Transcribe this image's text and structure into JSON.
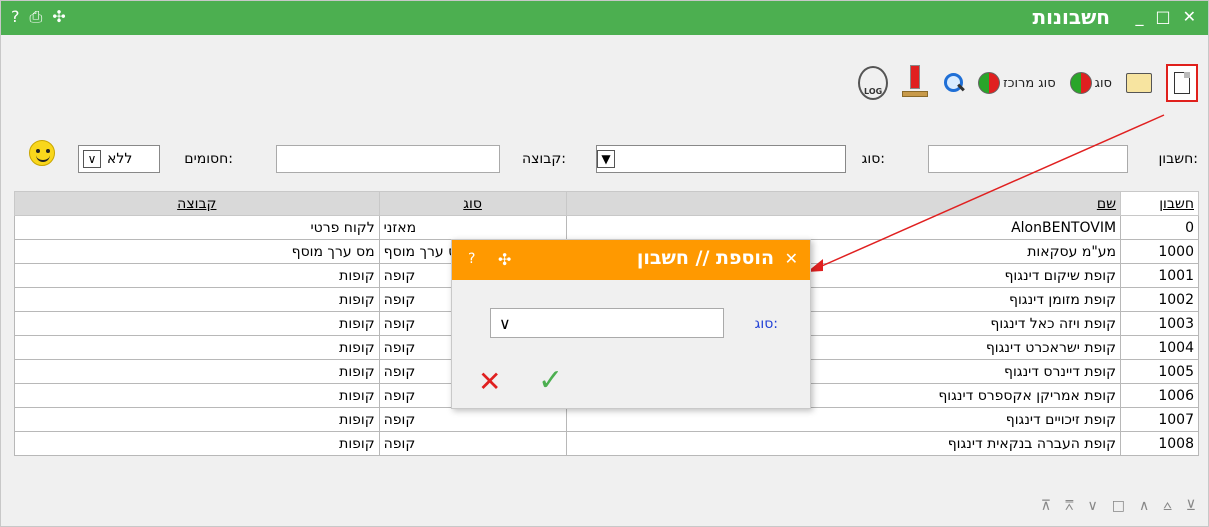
{
  "window": {
    "title": "חשבונות",
    "left_icons": [
      "?",
      "⎙",
      "✣"
    ],
    "controls": [
      "_",
      "□",
      "✕"
    ]
  },
  "toolbar": {
    "type_label": "סוג",
    "type_focus_label": "סוג מרוכז",
    "log_label": "LOG"
  },
  "filter": {
    "account_label": "חשבון:",
    "account_value": "",
    "type_label": "סוג:",
    "type_value": "",
    "group_label": "קבוצה:",
    "group_value": "",
    "blocked_label": "חסומים:",
    "blocked_value": "ללא"
  },
  "table": {
    "headers": {
      "account": "חשבון",
      "name": "שם",
      "type": "סוג",
      "group": "קבוצה"
    },
    "rows": [
      {
        "account": "0",
        "name": "AlonBENTOVIM",
        "type": "מאזני",
        "group": "לקוח פרטי"
      },
      {
        "account": "1000",
        "name": "מע\"מ עסקאות",
        "type": "מס ערך מוסף",
        "group": "מס ערך מוסף"
      },
      {
        "account": "1001",
        "name": "קופת שיקום דינגוף",
        "type": "קופה",
        "group": "קופות"
      },
      {
        "account": "1002",
        "name": "קופת מזומן דינגוף",
        "type": "קופה",
        "group": "קופות"
      },
      {
        "account": "1003",
        "name": "קופת ויזה כאל דינגוף",
        "type": "קופה",
        "group": "קופות"
      },
      {
        "account": "1004",
        "name": "קופת ישראכרט דינגוף",
        "type": "קופה",
        "group": "קופות"
      },
      {
        "account": "1005",
        "name": "קופת דיינרס דינגוף",
        "type": "קופה",
        "group": "קופות"
      },
      {
        "account": "1006",
        "name": "קופת אמריקן אקספרס דינגוף",
        "type": "קופה",
        "group": "קופות"
      },
      {
        "account": "1007",
        "name": "קופת זיכויים דינגוף",
        "type": "קופה",
        "group": "קופות"
      },
      {
        "account": "1008",
        "name": "קופת העברה בנקאית דינגוף",
        "type": "קופה",
        "group": "קופות"
      }
    ]
  },
  "nav": [
    "⊼",
    "⩞",
    "∨",
    "□",
    "∧",
    "⩟",
    "⊻"
  ],
  "dialog": {
    "title": "הוספת // חשבון",
    "help": "?",
    "move": "✣",
    "close": "✕",
    "type_label": "סוג:",
    "type_value": "",
    "cancel": "✕",
    "ok": "✓"
  },
  "colors": {
    "title_bar": "#4caf50",
    "dialog_title": "#ff9900",
    "highlight": "#e02020"
  }
}
